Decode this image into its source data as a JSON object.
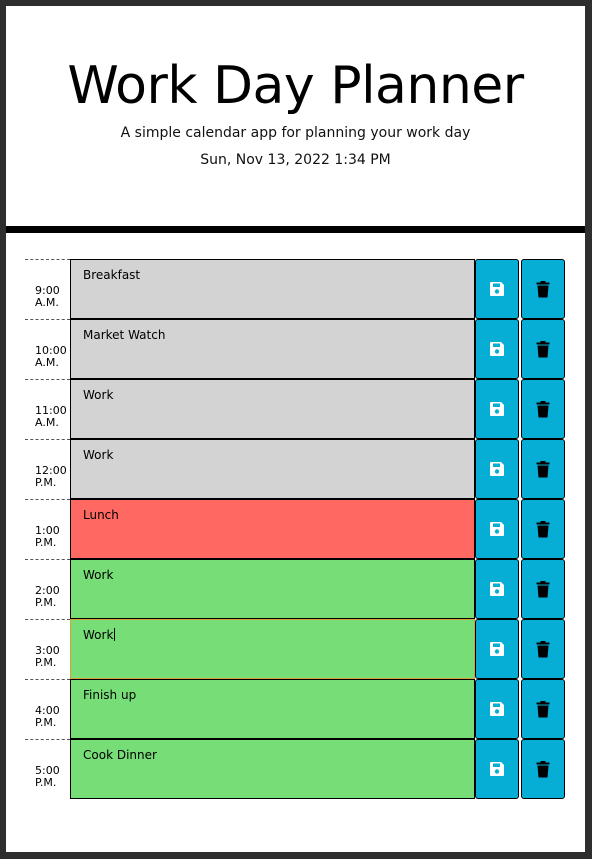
{
  "header": {
    "title": "Work Day Planner",
    "subtitle": "A simple calendar app for planning your work day",
    "datetime": "Sun, Nov 13, 2022 1:34 PM"
  },
  "colors": {
    "past": "#d3d3d3",
    "present": "#ff6961",
    "future": "#77dd77",
    "button": "#06aed5"
  },
  "hours": [
    {
      "time": "9:00",
      "period": "A.M.",
      "text": "Breakfast",
      "state": "past"
    },
    {
      "time": "10:00",
      "period": "A.M.",
      "text": "Market Watch",
      "state": "past"
    },
    {
      "time": "11:00",
      "period": "A.M.",
      "text": "Work",
      "state": "past"
    },
    {
      "time": "12:00",
      "period": "P.M.",
      "text": "Work",
      "state": "past"
    },
    {
      "time": "1:00",
      "period": "P.M.",
      "text": "Lunch",
      "state": "present"
    },
    {
      "time": "2:00",
      "period": "P.M.",
      "text": "Work",
      "state": "future"
    },
    {
      "time": "3:00",
      "period": "P.M.",
      "text": "Work",
      "state": "future"
    },
    {
      "time": "4:00",
      "period": "P.M.",
      "text": "Finish up",
      "state": "future"
    },
    {
      "time": "5:00",
      "period": "P.M.",
      "text": "Cook Dinner",
      "state": "future"
    }
  ],
  "icons": {
    "save": "floppy-disk-icon",
    "delete": "trash-icon"
  }
}
